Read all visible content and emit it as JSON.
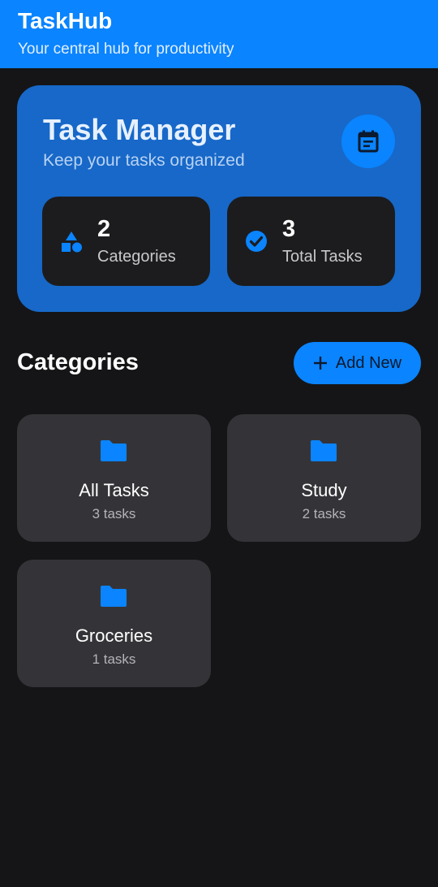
{
  "appbar": {
    "title": "TaskHub",
    "subtitle": "Your central hub for productivity"
  },
  "hero": {
    "title": "Task Manager",
    "subtitle": "Keep your tasks organized",
    "calendar_icon": "calendar-icon",
    "stats": [
      {
        "value": "2",
        "label": "Categories",
        "icon": "shapes-icon"
      },
      {
        "value": "3",
        "label": "Total Tasks",
        "icon": "check-circle-icon"
      }
    ]
  },
  "categories_section": {
    "title": "Categories",
    "add_button_label": "Add New",
    "items": [
      {
        "name": "All Tasks",
        "count": "3 tasks",
        "icon": "folder-icon"
      },
      {
        "name": "Study",
        "count": "2 tasks",
        "icon": "folder-icon"
      },
      {
        "name": "Groceries",
        "count": "1 tasks",
        "icon": "folder-icon"
      }
    ]
  },
  "colors": {
    "background": "#151517",
    "accent": "#0a84ff",
    "hero_bg": "#1768c8",
    "stat_card_bg": "#1c1c1e",
    "category_card_bg": "#343438"
  }
}
